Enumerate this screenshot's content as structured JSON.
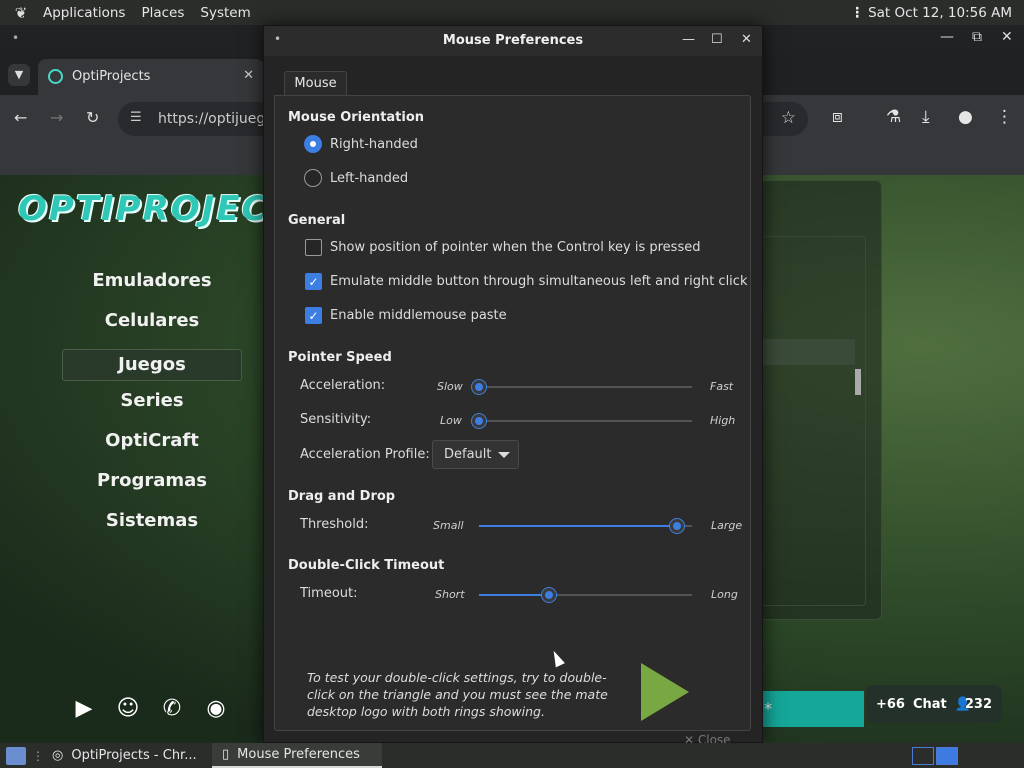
{
  "top_panel": {
    "menus": [
      "Applications",
      "Places",
      "System"
    ],
    "clock": "Sat Oct 12, 10:56 AM"
  },
  "browser": {
    "tab_title": "OptiProjects",
    "url": "https://optijuego",
    "site": {
      "brand": "OPTIPROJECTS",
      "nav": [
        "Emuladores",
        "Celulares",
        "Juegos",
        "Series",
        "OptiCraft",
        "Programas",
        "Sistemas"
      ],
      "active_nav": "Juegos",
      "chat": {
        "count": "+66",
        "label": "Chat",
        "users": "232"
      },
      "teal_button": "*"
    }
  },
  "dialog": {
    "title": "Mouse Preferences",
    "tab": "Mouse",
    "orientation": {
      "heading": "Mouse Orientation",
      "right": "Right-handed",
      "left": "Left-handed",
      "selected": "right"
    },
    "general": {
      "heading": "General",
      "show_pointer": {
        "label": "Show position of pointer when the Control key is pressed",
        "checked": false
      },
      "emulate_middle": {
        "label": "Emulate middle button through simultaneous left and right click",
        "checked": true
      },
      "middle_paste": {
        "label": "Enable middlemouse paste",
        "checked": true
      }
    },
    "pointer_speed": {
      "heading": "Pointer Speed",
      "acceleration": {
        "label": "Acceleration:",
        "min": "Slow",
        "max": "Fast",
        "value": 0.0
      },
      "sensitivity": {
        "label": "Sensitivity:",
        "min": "Low",
        "max": "High",
        "value": 0.0
      },
      "profile": {
        "label": "Acceleration Profile:",
        "value": "Default"
      }
    },
    "drag_drop": {
      "heading": "Drag and Drop",
      "threshold": {
        "label": "Threshold:",
        "min": "Small",
        "max": "Large",
        "value": 0.93
      }
    },
    "double_click": {
      "heading": "Double-Click Timeout",
      "timeout": {
        "label": "Timeout:",
        "min": "Short",
        "max": "Long",
        "value": 0.33
      },
      "hint": "To test your double-click settings, try to double-click on the triangle and you must see the mate desktop logo with both rings showing."
    },
    "bottom_button": "Close"
  },
  "taskbar": {
    "tasks": [
      "OptiProjects - Chr...",
      "Mouse Preferences"
    ]
  },
  "colors": {
    "accent": "#3d7ee3",
    "triangle": "#79a843",
    "brand": "#2fc7b5"
  }
}
